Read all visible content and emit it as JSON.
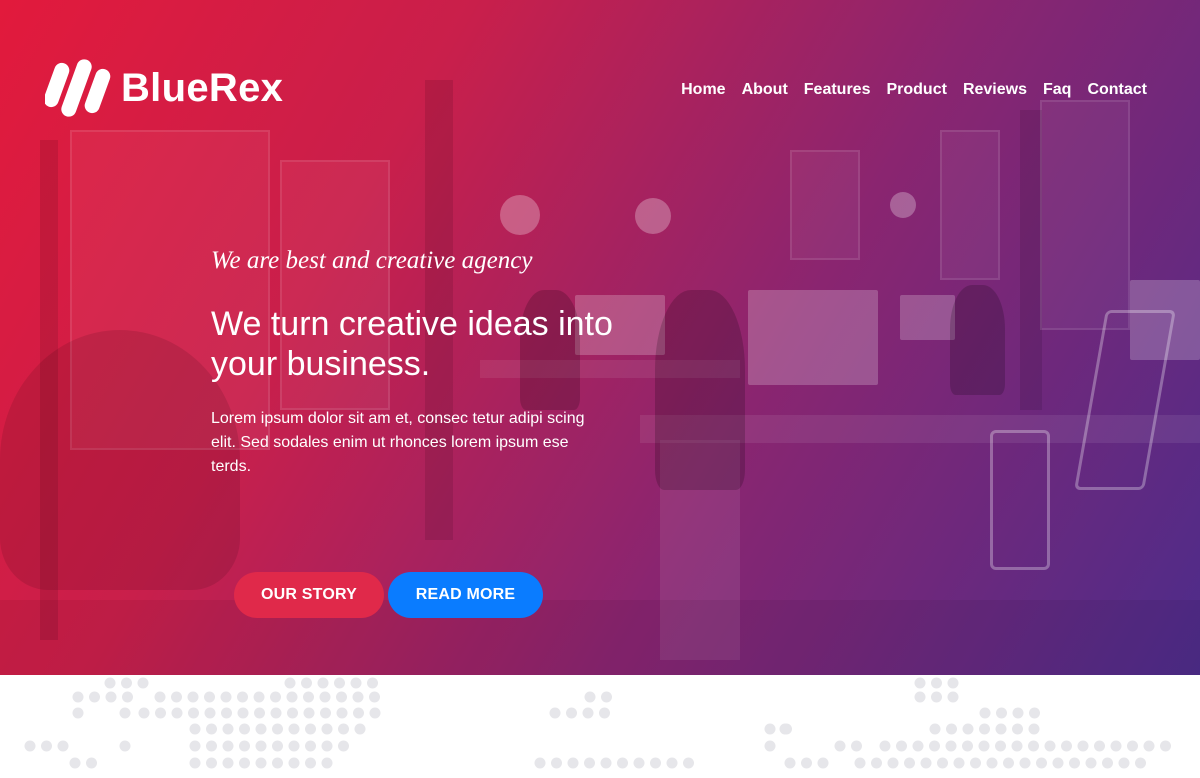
{
  "brand": {
    "name": "BlueRex"
  },
  "nav": {
    "items": [
      "Home",
      "About",
      "Features",
      "Product",
      "Reviews",
      "Faq",
      "Contact"
    ]
  },
  "hero": {
    "tagline": "We are best and creative agency",
    "headline": "We turn creative ideas into your business.",
    "body": "Lorem ipsum dolor sit am et, consec tetur adipi scing elit. Sed sodales enim ut rhonces lorem ipsum ese terds.",
    "primary_button": "OUR STORY",
    "secondary_button": "READ MORE"
  },
  "colors": {
    "gradient_start": "#e21a3c",
    "gradient_end": "#4d2c8a",
    "button_story": "#e0294a",
    "button_more": "#0a7cff",
    "map_dots": "#e6e6ea"
  },
  "icons": {
    "logo": "logo-mark-icon"
  }
}
